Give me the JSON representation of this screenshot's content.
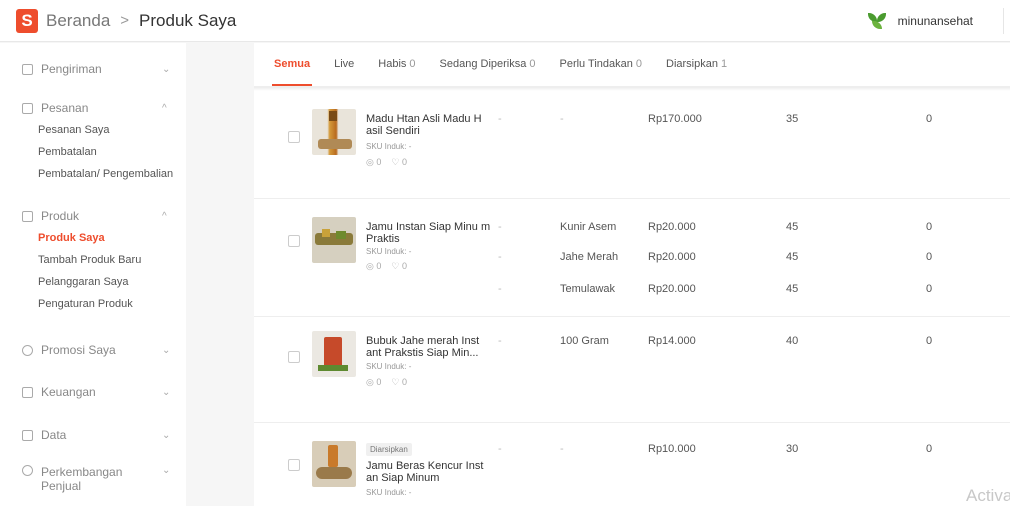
{
  "header": {
    "logo_letter": "S",
    "breadcrumb_home": "Beranda",
    "breadcrumb_sep": ">",
    "breadcrumb_current": "Produk Saya",
    "username": "minunansehat",
    "brand_color": "#ee4d2d"
  },
  "sidebar": {
    "pengiriman": {
      "label": "Pengiriman",
      "icon": "box-icon",
      "chevron": "⌄"
    },
    "pesanan": {
      "label": "Pesanan",
      "icon": "clipboard-icon",
      "chevron": "^",
      "items": [
        "Pesanan Saya",
        "Pembatalan",
        "Pembatalan/ Pengembalian"
      ]
    },
    "produk": {
      "label": "Produk",
      "icon": "box-icon",
      "chevron": "^",
      "items": [
        "Produk Saya",
        "Tambah Produk Baru",
        "Pelanggaran Saya",
        "Pengaturan Produk"
      ],
      "active_index": 0
    },
    "promosi": {
      "label": "Promosi Saya",
      "icon": "tag-icon",
      "chevron": "⌄"
    },
    "keuangan": {
      "label": "Keuangan",
      "icon": "wallet-icon",
      "chevron": "⌄"
    },
    "data": {
      "label": "Data",
      "icon": "chart-icon",
      "chevron": "⌄"
    },
    "perkembangan": {
      "label_line1": "Perkembangan",
      "label_line2": "Penjual",
      "icon": "badge-icon",
      "chevron": "⌄"
    }
  },
  "tabs": [
    {
      "label": "Semua",
      "count": "",
      "active": true
    },
    {
      "label": "Live",
      "count": ""
    },
    {
      "label": "Habis",
      "count": "0"
    },
    {
      "label": "Sedang Diperiksa",
      "count": "0"
    },
    {
      "label": "Perlu Tindakan",
      "count": "0"
    },
    {
      "label": "Diarsipkan",
      "count": "1"
    }
  ],
  "products": [
    {
      "name": "Madu Htan Asli Madu H asil Sendiri",
      "sku": "SKU Induk: -",
      "views": "0",
      "likes": "0",
      "variants": [
        {
          "dash": "-",
          "variant": "-",
          "price": "Rp170.000",
          "stock": "35",
          "sales": "0"
        }
      ]
    },
    {
      "name": "Jamu Instan Siap Minu m Praktis",
      "sku": "SKU Induk: -",
      "views": "0",
      "likes": "0",
      "variants": [
        {
          "dash": "-",
          "variant": "Kunir Asem",
          "price": "Rp20.000",
          "stock": "45",
          "sales": "0"
        },
        {
          "dash": "-",
          "variant": "Jahe Merah",
          "price": "Rp20.000",
          "stock": "45",
          "sales": "0"
        },
        {
          "dash": "-",
          "variant": "Temulawak",
          "price": "Rp20.000",
          "stock": "45",
          "sales": "0"
        }
      ]
    },
    {
      "name": "Bubuk Jahe merah Inst ant Prakstis Siap Min...",
      "sku": "SKU Induk: -",
      "views": "0",
      "likes": "0",
      "variants": [
        {
          "dash": "-",
          "variant": "100 Gram",
          "price": "Rp14.000",
          "stock": "40",
          "sales": "0"
        }
      ]
    },
    {
      "badge": "Diarsipkan",
      "name": "Jamu Beras Kencur Inst an Siap Minum",
      "sku": "SKU Induk: -",
      "variants": [
        {
          "dash": "-",
          "variant": "-",
          "price": "Rp10.000",
          "stock": "30",
          "sales": "0"
        }
      ]
    }
  ],
  "icons": {
    "views": "◎",
    "likes": "♡"
  },
  "watermark": "Activate Windows"
}
